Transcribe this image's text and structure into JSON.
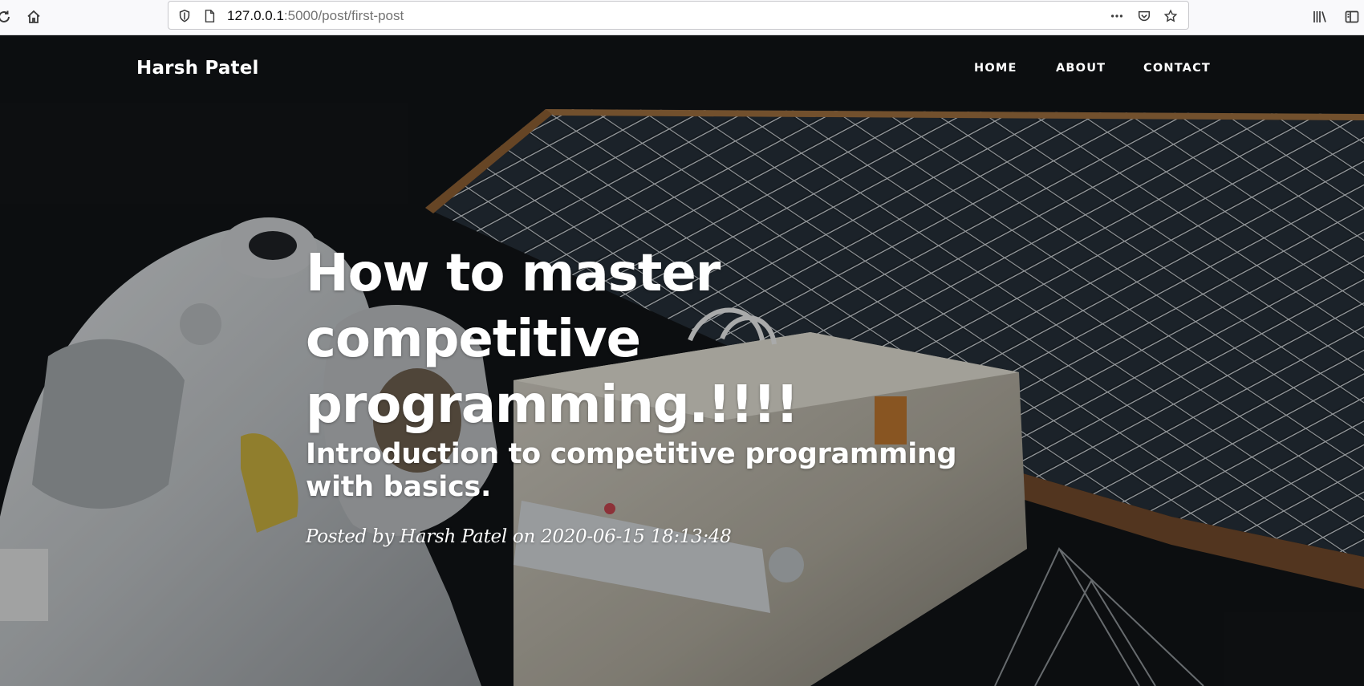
{
  "browser": {
    "url_host": "127.0.0.1",
    "url_path": ":5000/post/first-post",
    "icons": [
      "reload-icon",
      "home-icon",
      "shield-icon",
      "page-icon",
      "more-icon",
      "pocket-icon",
      "bookmark-star-icon",
      "library-icon",
      "sidebar-icon"
    ]
  },
  "nav": {
    "brand": "Harsh Patel",
    "links": [
      {
        "label": "Home"
      },
      {
        "label": "About"
      },
      {
        "label": "Contact"
      }
    ]
  },
  "post": {
    "title_lines": [
      "How to master",
      "competitive",
      "programming.!!!!"
    ],
    "subtitle": "Introduction to competitive programming with basics.",
    "meta": {
      "prefix": "Posted by",
      "author": "Harsh Patel",
      "on": "on",
      "date": "2020-06-15 18:13:48"
    }
  },
  "colors": {
    "hero_background": "#0d0f11",
    "text": "#ffffff",
    "toolbar": "#f9f9fb"
  }
}
